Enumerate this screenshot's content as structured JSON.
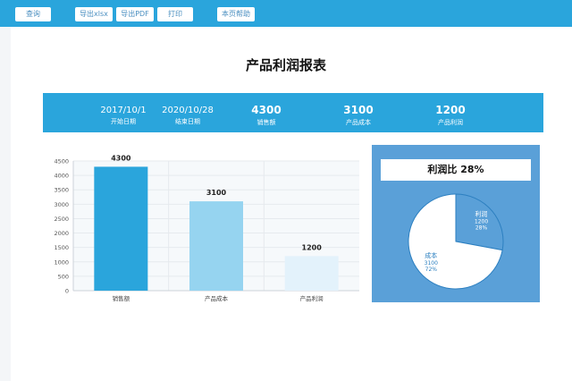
{
  "toolbar": {
    "query": "查询",
    "export_xlsx": "导出xlsx",
    "export_pdf": "导出PDF",
    "print": "打印",
    "help": "本页帮助"
  },
  "report": {
    "title": "产品利润报表"
  },
  "summary": {
    "start_date": "2017/10/1",
    "start_label": "开始日期",
    "end_date": "2020/10/28",
    "end_label": "结束日期",
    "sales": "4300",
    "sales_label": "销售额",
    "cost": "3100",
    "cost_label": "产品成本",
    "profit": "1200",
    "profit_label": "产品利润"
  },
  "colors": {
    "primary": "#2aa5dc",
    "panel": "#5aa0d8",
    "bar1": "#2aa5dc",
    "bar2": "#96d4f0",
    "bar3": "#e3f2fb"
  },
  "chart_data": [
    {
      "type": "bar",
      "categories": [
        "销售额",
        "产品成本",
        "产品利润"
      ],
      "values": [
        4300,
        3100,
        1200
      ],
      "ylim": [
        0,
        4500
      ],
      "yticks": [
        0,
        500,
        1000,
        1500,
        2000,
        2500,
        3000,
        3500,
        4000,
        4500
      ],
      "grid": true
    },
    {
      "type": "pie",
      "title": "利润比 28%",
      "slices": [
        {
          "label": "利润",
          "value": 1200,
          "percent": "28%",
          "color": "#5aa0d8"
        },
        {
          "label": "成本",
          "value": 3100,
          "percent": "72%",
          "color": "#ffffff"
        }
      ]
    }
  ]
}
